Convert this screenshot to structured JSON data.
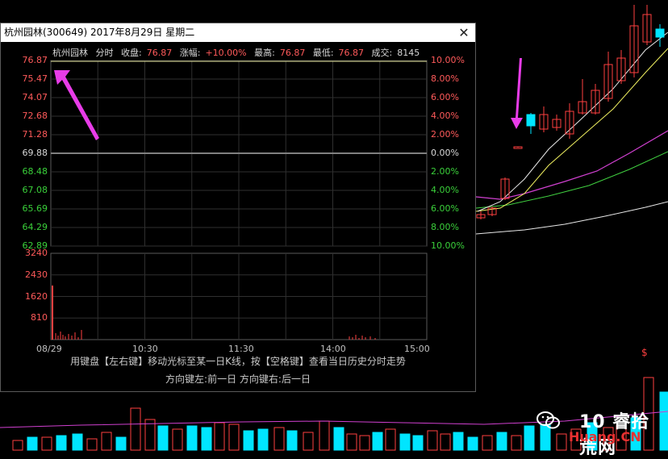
{
  "popup": {
    "title": "杭州园林(300649) 2017年8月29日 星期二",
    "close_glyph": "✕",
    "info": {
      "name": "杭州园林",
      "mode": "分时",
      "close_label": "收盘:",
      "close_value": "76.87",
      "change_label": "涨幅:",
      "change_value": "+10.00%",
      "high_label": "最高:",
      "high_value": "76.87",
      "low_label": "最低:",
      "low_value": "76.87",
      "volume_label": "成交:",
      "volume_value": "8145"
    },
    "price_ticks": [
      "76.87",
      "75.47",
      "74.07",
      "72.68",
      "71.28",
      "69.88",
      "68.48",
      "67.08",
      "65.69",
      "64.29",
      "62.89"
    ],
    "pct_ticks": [
      "10.00%",
      "8.00%",
      "6.00%",
      "4.00%",
      "2.00%",
      "0.00%",
      "2.00%",
      "4.00%",
      "6.00%",
      "8.00%",
      "10.00%"
    ],
    "volume_ticks": [
      "3240",
      "2430",
      "1620",
      "810"
    ],
    "time_ticks": [
      "08/29",
      "10:30",
      "11:30",
      "14:00",
      "15:00"
    ],
    "hint_line1": "用键盘【左右键】移动光标至某一日K线，按【空格键】查看当日历史分时走势",
    "hint_line2": "方向键左:前一日    方向键右:后一日"
  },
  "watermark": {
    "line1": "10 睿拾荒网",
    "line2": "Huang.CN"
  },
  "colors": {
    "up": "#ff4040",
    "down": "#00e5ff",
    "arrow": "#e83ce8",
    "ma_white": "#e8e8e8",
    "ma_yellow": "#f0f060",
    "ma_magenta": "#d040d0",
    "ma_green": "#40d040"
  }
}
